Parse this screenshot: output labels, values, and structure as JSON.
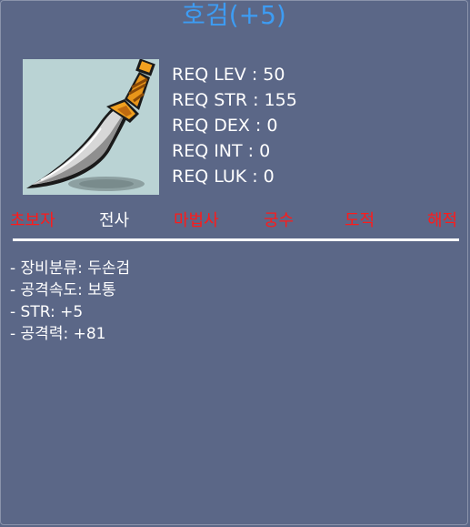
{
  "item": {
    "name": "호검(+5)",
    "icon": "curved-sword-icon"
  },
  "requirements": [
    "REQ LEV : 50",
    "REQ STR : 155",
    "REQ DEX : 0",
    "REQ INT : 0",
    "REQ LUK : 0"
  ],
  "jobs": [
    {
      "label": "초보자",
      "status": "unavailable"
    },
    {
      "label": "전사",
      "status": "available"
    },
    {
      "label": "마법사",
      "status": "unavailable"
    },
    {
      "label": "궁수",
      "status": "unavailable"
    },
    {
      "label": "도적",
      "status": "unavailable"
    },
    {
      "label": "해적",
      "status": "unavailable"
    }
  ],
  "stats": [
    "- 장비분류: 두손검",
    "- 공격속도: 보통",
    "- STR: +5",
    "- 공격력: +81"
  ],
  "colors": {
    "background": "#5b6787",
    "title": "#3d9cf3",
    "unavailable": "#ff1a1a",
    "available": "#ffffff",
    "icon_bg": "#bad3d4"
  }
}
